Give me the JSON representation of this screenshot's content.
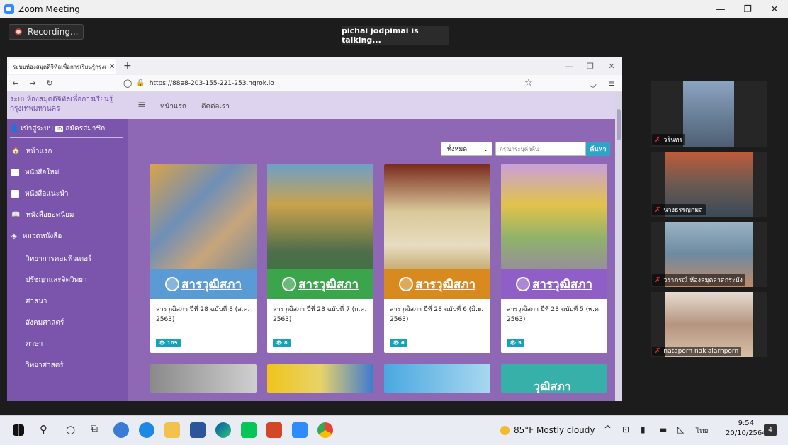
{
  "zoom": {
    "window_title": "Zoom Meeting",
    "recording_label": "Recording...",
    "talking_label": "pichai jodpimai is talking..."
  },
  "browser": {
    "tab_title": "ระบบห้องสมุดดิจิทัลเพื่อการเรียนรู้กรุงเ",
    "new_tab": "+",
    "url": "https://88e8-203-155-221-253.ngrok.io"
  },
  "site": {
    "title": "ระบบห้องสมุดดิจิทัลเพื่อการเรียนรู้ กรุงเทพมหานคร",
    "nav": {
      "home": "หน้าแรก",
      "contact": "ติดต่อเรา"
    },
    "auth": {
      "login": "เข้าสู่ระบบ",
      "register": "สมัครสมาชิก"
    },
    "sidebar": {
      "items": [
        "หน้าแรก",
        "หนังสือใหม่",
        "หนังสือแนะนำ",
        "หนังสือยอดนิยม",
        "หมวดหนังสือ"
      ],
      "categories": [
        "วิทยาการคอมพิวเตอร์",
        "ปรัชญาและจิตวิทยา",
        "ศาสนา",
        "สังคมศาสตร์",
        "ภาษา",
        "วิทยาศาสตร์"
      ]
    },
    "search": {
      "filter": "ทั้งหมด",
      "placeholder": "กรุณาระบุคำค้น",
      "button": "ค้นหา"
    },
    "books": [
      {
        "title": "สารวุฒิสภา ปีที่ 28 ฉบับที่ 8 (ส.ค. 2563)",
        "dash": "-",
        "views": "109",
        "brand": "สารวุฒิสภา",
        "color": "#5b9bd5"
      },
      {
        "title": "สารวุฒิสภา ปีที่ 28 ฉบับที่ 7 (ก.ค. 2563)",
        "dash": "-",
        "views": "8",
        "brand": "สารวุฒิสภา",
        "color": "#3aa54a"
      },
      {
        "title": "สารวุฒิสภา ปีที่ 28 ฉบับที่ 6 (มิ.ย. 2563)",
        "dash": "-",
        "views": "6",
        "brand": "สารวุฒิสภา",
        "color": "#d88a1f"
      },
      {
        "title": "สารวุฒิสภา ปีที่ 28 ฉบับที่ 5 (พ.ค. 2563)",
        "dash": "-",
        "views": "5",
        "brand": "สารวุฒิสภา",
        "color": "#8f5fc7"
      }
    ],
    "next_row_brand": "วุฒิสภา"
  },
  "participants": [
    {
      "name": "วรินทร",
      "color": "#7b8a9e"
    },
    {
      "name": "นางธรรญกมล",
      "color": "#8a6b5a"
    },
    {
      "name": "วราภรณ์ ห้องสมุดลาดกระบัง",
      "color": "#6e8aa0"
    },
    {
      "name": "nataporn nakjalarnporn",
      "color": "#b59580"
    }
  ],
  "taskbar": {
    "weather": "85°F Mostly cloudy",
    "lang": "ไทย",
    "time": "9:54",
    "date": "20/10/2564",
    "notifications": "4"
  }
}
